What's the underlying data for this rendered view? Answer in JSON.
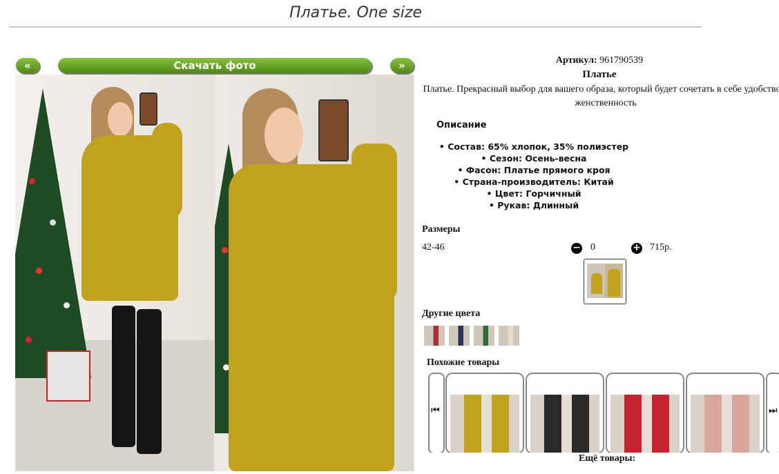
{
  "page": {
    "title": "Платье. One size"
  },
  "gallery": {
    "prev_label": "«",
    "next_label": "»",
    "download_label": "Скачать фото"
  },
  "product": {
    "articul_label": "Артикул:",
    "articul_value": "961790539",
    "name": "Платье",
    "description": "Платье. Прекрасный выбор для вашего образа, который будет сочетать в себе удобство и женственность",
    "description_title": "Описание",
    "specs": [
      "Состав: 65% хлопок, 35% полиэстер",
      "Сезон: Осень-весна",
      "Фасон: Платье прямого кроя",
      "Страна-производитель: Китай",
      "Цвет: Горчичный",
      "Рукав: Длинный"
    ]
  },
  "sizes": {
    "title": "Размеры",
    "rows": [
      {
        "range": "42-46",
        "quantity": "0",
        "price": "715р."
      }
    ]
  },
  "other_colors": {
    "title": "Другие цвета",
    "colors": [
      "#a8323a",
      "#2c3458",
      "#2f6a3a",
      "#e6dcd0"
    ]
  },
  "similar": {
    "title": "Похожие товары",
    "item_colors": [
      "#c0a21d",
      "#2a2a2a",
      "#c82430",
      "#d8a69a"
    ]
  },
  "more": {
    "title": "Ещё товары:"
  },
  "colors": {
    "accent_green": "#5a9a1e",
    "dress_mustard": "#c0a21d"
  }
}
